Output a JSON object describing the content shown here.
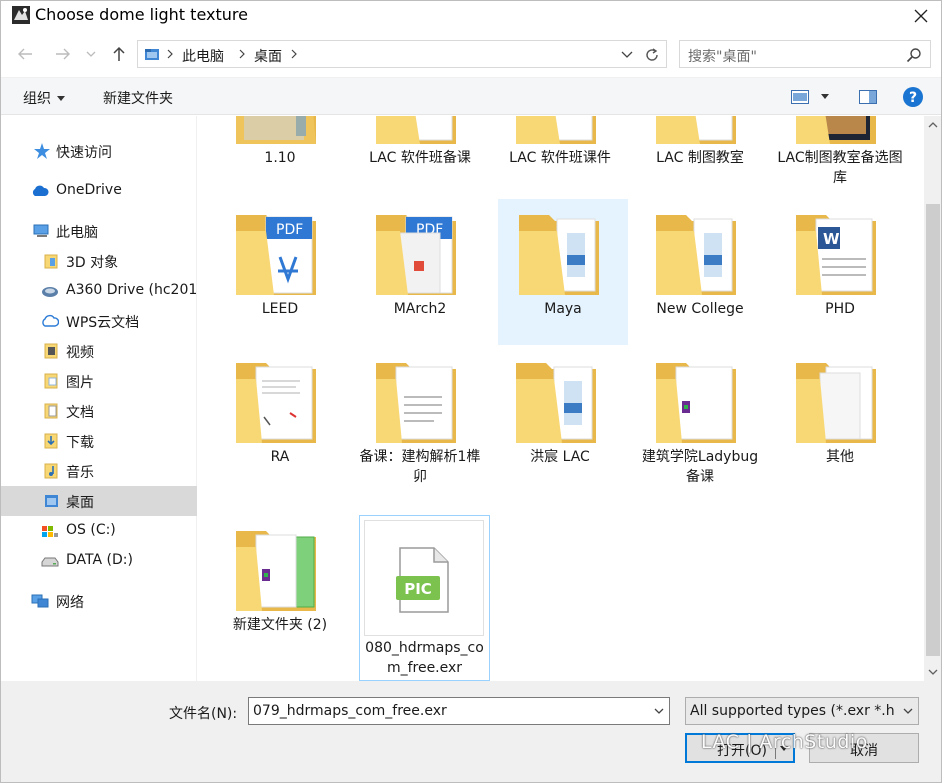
{
  "window": {
    "title": "Choose dome light texture"
  },
  "address": {
    "crumbs": [
      "此电脑",
      "桌面"
    ],
    "search_placeholder": "搜索\"桌面\""
  },
  "toolbar": {
    "organize_label": "组织",
    "new_folder_label": "新建文件夹"
  },
  "sidebar": {
    "items": [
      {
        "label": "快速访问",
        "icon": "star-icon"
      },
      {
        "label": "OneDrive",
        "icon": "cloud-icon"
      },
      {
        "label": "此电脑",
        "icon": "computer-icon"
      },
      {
        "label": "3D 对象",
        "icon": "3d-objects-icon"
      },
      {
        "label": "A360 Drive (hc201",
        "icon": "a360-drive-icon"
      },
      {
        "label": "WPS云文档",
        "icon": "wps-cloud-icon"
      },
      {
        "label": "视频",
        "icon": "videos-icon"
      },
      {
        "label": "图片",
        "icon": "pictures-icon"
      },
      {
        "label": "文档",
        "icon": "documents-icon"
      },
      {
        "label": "下载",
        "icon": "downloads-icon"
      },
      {
        "label": "音乐",
        "icon": "music-icon"
      },
      {
        "label": "桌面",
        "icon": "desktop-icon",
        "selected": true
      },
      {
        "label": "OS (C:)",
        "icon": "os-drive-icon"
      },
      {
        "label": "DATA (D:)",
        "icon": "data-drive-icon"
      },
      {
        "label": "网络",
        "icon": "network-icon"
      }
    ]
  },
  "files": [
    {
      "name": "1.10",
      "kind": "folder-gray"
    },
    {
      "name": "LAC 软件班备课",
      "kind": "folder-docs"
    },
    {
      "name": "LAC 软件班课件",
      "kind": "folder-docs"
    },
    {
      "name": "LAC 制图教室",
      "kind": "folder-docs"
    },
    {
      "name": "LAC制图教室备选图库",
      "kind": "folder-photo"
    },
    {
      "name": "LEED",
      "kind": "folder-pdf"
    },
    {
      "name": "MArch2",
      "kind": "folder-pdf2"
    },
    {
      "name": "Maya",
      "kind": "folder-blue",
      "hover": true
    },
    {
      "name": "New College",
      "kind": "folder-blue"
    },
    {
      "name": "PHD",
      "kind": "folder-word"
    },
    {
      "name": "RA",
      "kind": "folder-doc"
    },
    {
      "name": "备课：建构解析1榫卯",
      "kind": "folder-doc"
    },
    {
      "name": "洪宸 LAC",
      "kind": "folder-blue"
    },
    {
      "name": "建筑学院Ladybug备课",
      "kind": "folder-rar"
    },
    {
      "name": "其他",
      "kind": "folder-plain"
    },
    {
      "name": "新建文件夹 (2)",
      "kind": "folder-green"
    },
    {
      "name": "080_hdrmaps_com_free.exr",
      "kind": "file-pic",
      "selected": true
    }
  ],
  "pic_badge": "PIC",
  "pdf_badge": "PDF",
  "word_badge": "W",
  "bottom": {
    "filename_label": "文件名(N):",
    "filename_value": "079_hdrmaps_com_free.exr",
    "filetype_value": "All supported types (*.exr *.h",
    "open_label": "打开(O)",
    "cancel_label": "取消"
  },
  "watermark": "LAC | ArchStudio",
  "colors": {
    "accent": "#0078d7",
    "folder": "#f8d775",
    "folder_dark": "#e8b84a",
    "selected_nav": "#d9d9d9",
    "hover_tile": "#e5f3ff"
  }
}
